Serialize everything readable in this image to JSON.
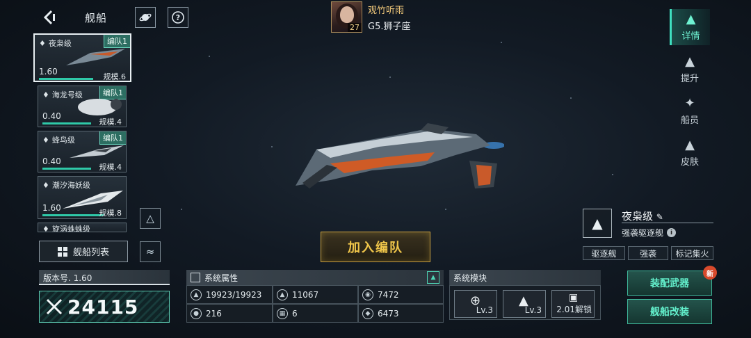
{
  "header": {
    "title": "舰船",
    "player_name": "观竹听雨",
    "player_level": "27",
    "player_galaxy": "G5.狮子座"
  },
  "right_tabs": [
    {
      "label": "详情",
      "icon": "fighter-icon",
      "active": true
    },
    {
      "label": "提升",
      "icon": "upgrade-icon",
      "active": false
    },
    {
      "label": "船员",
      "icon": "crew-icon",
      "active": false
    },
    {
      "label": "皮肤",
      "icon": "skin-icon",
      "active": false
    }
  ],
  "ships": [
    {
      "name": "夜枭级",
      "badge": "编队1",
      "power": "1.60",
      "scale": "规模.6",
      "fill": 0.78,
      "selected": true
    },
    {
      "name": "海龙号级",
      "badge": "编队1",
      "power": "0.40",
      "scale": "规模.4",
      "fill": 0.55
    },
    {
      "name": "蜂鸟级",
      "badge": "编队1",
      "power": "0.40",
      "scale": "规模.4",
      "fill": 0.55
    },
    {
      "name": "潮汐海妖级",
      "badge": "",
      "power": "1.60",
      "scale": "规模.8",
      "fill": 0.7
    },
    {
      "name": "旋涡蛛蛛级",
      "badge": "",
      "power": "",
      "scale": "",
      "fill": 0
    }
  ],
  "fleet_list_label": "舰船列表",
  "version_label": "版本号. 1.60",
  "combat_power": "24115",
  "attributes": {
    "title": "系统属性",
    "items": [
      {
        "icon": "hull-icon",
        "value": "19923/19923"
      },
      {
        "icon": "armor-icon",
        "value": "11067"
      },
      {
        "icon": "shield-icon",
        "value": "7472"
      },
      {
        "icon": "speed-icon",
        "value": "216"
      },
      {
        "icon": "energy-icon",
        "value": "6"
      },
      {
        "icon": "target-icon",
        "value": "6473"
      }
    ]
  },
  "modules": {
    "title": "系统模块",
    "items": [
      {
        "icon": "crosshair-module-icon",
        "label": "Lv.3"
      },
      {
        "icon": "engine-module-icon",
        "label": "Lv.3"
      },
      {
        "icon": "lock-icon",
        "label": "2.01解锁"
      }
    ]
  },
  "join_button": "加入编队",
  "ship_info": {
    "name": "夜枭级",
    "type": "强袭驱逐舰",
    "tags": [
      "驱逐舰",
      "强袭",
      "标记集火"
    ]
  },
  "actions": {
    "equip": "装配武器",
    "new_badge": "新",
    "modify": "舰船改装"
  },
  "colors": {
    "accent": "#3fe0c0",
    "gold": "#f0c64a",
    "bg": "#121a24"
  }
}
